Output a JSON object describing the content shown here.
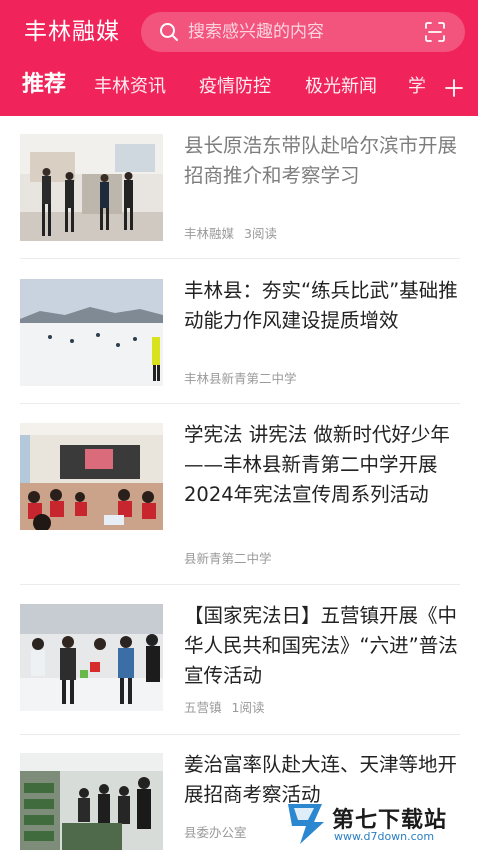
{
  "header": {
    "app_title": "丰林融媒",
    "search_placeholder": "搜索感兴趣的内容",
    "bg_color": "#f0245a",
    "icons": [
      "search-icon",
      "scan-icon",
      "plus-icon"
    ]
  },
  "tabs": [
    {
      "label": "推荐",
      "active": true
    },
    {
      "label": "丰林资讯",
      "active": false
    },
    {
      "label": "疫情防控",
      "active": false
    },
    {
      "label": "极光新闻",
      "active": false
    },
    {
      "label": "学",
      "active": false
    }
  ],
  "articles": [
    {
      "title": "县长原浩东带队赴哈尔滨市开展招商推介和考察学习",
      "source": "丰林融媒",
      "reads": "3阅读",
      "read": true
    },
    {
      "title": "丰林县：夯实“练兵比武”基础推动能力作风建设提质增效",
      "source": "丰林县新青第二中学",
      "reads": "",
      "read": false
    },
    {
      "title": "学宪法 讲宪法 做新时代好少年——丰林县新青第二中学开展2024年宪法宣传周系列活动",
      "source": "县新青第二中学",
      "reads": "",
      "read": false
    },
    {
      "title": "【国家宪法日】五营镇开展《中华人民共和国宪法》“六进”普法宣传活动",
      "source": "五营镇",
      "reads": "1阅读",
      "read": false
    },
    {
      "title": "姜治富率队赴大连、天津等地开展招商考察活动",
      "source": "县委办公室",
      "reads": "",
      "read": false
    }
  ],
  "watermark": {
    "text": "第七下载站",
    "url": "www.d7down.com"
  }
}
